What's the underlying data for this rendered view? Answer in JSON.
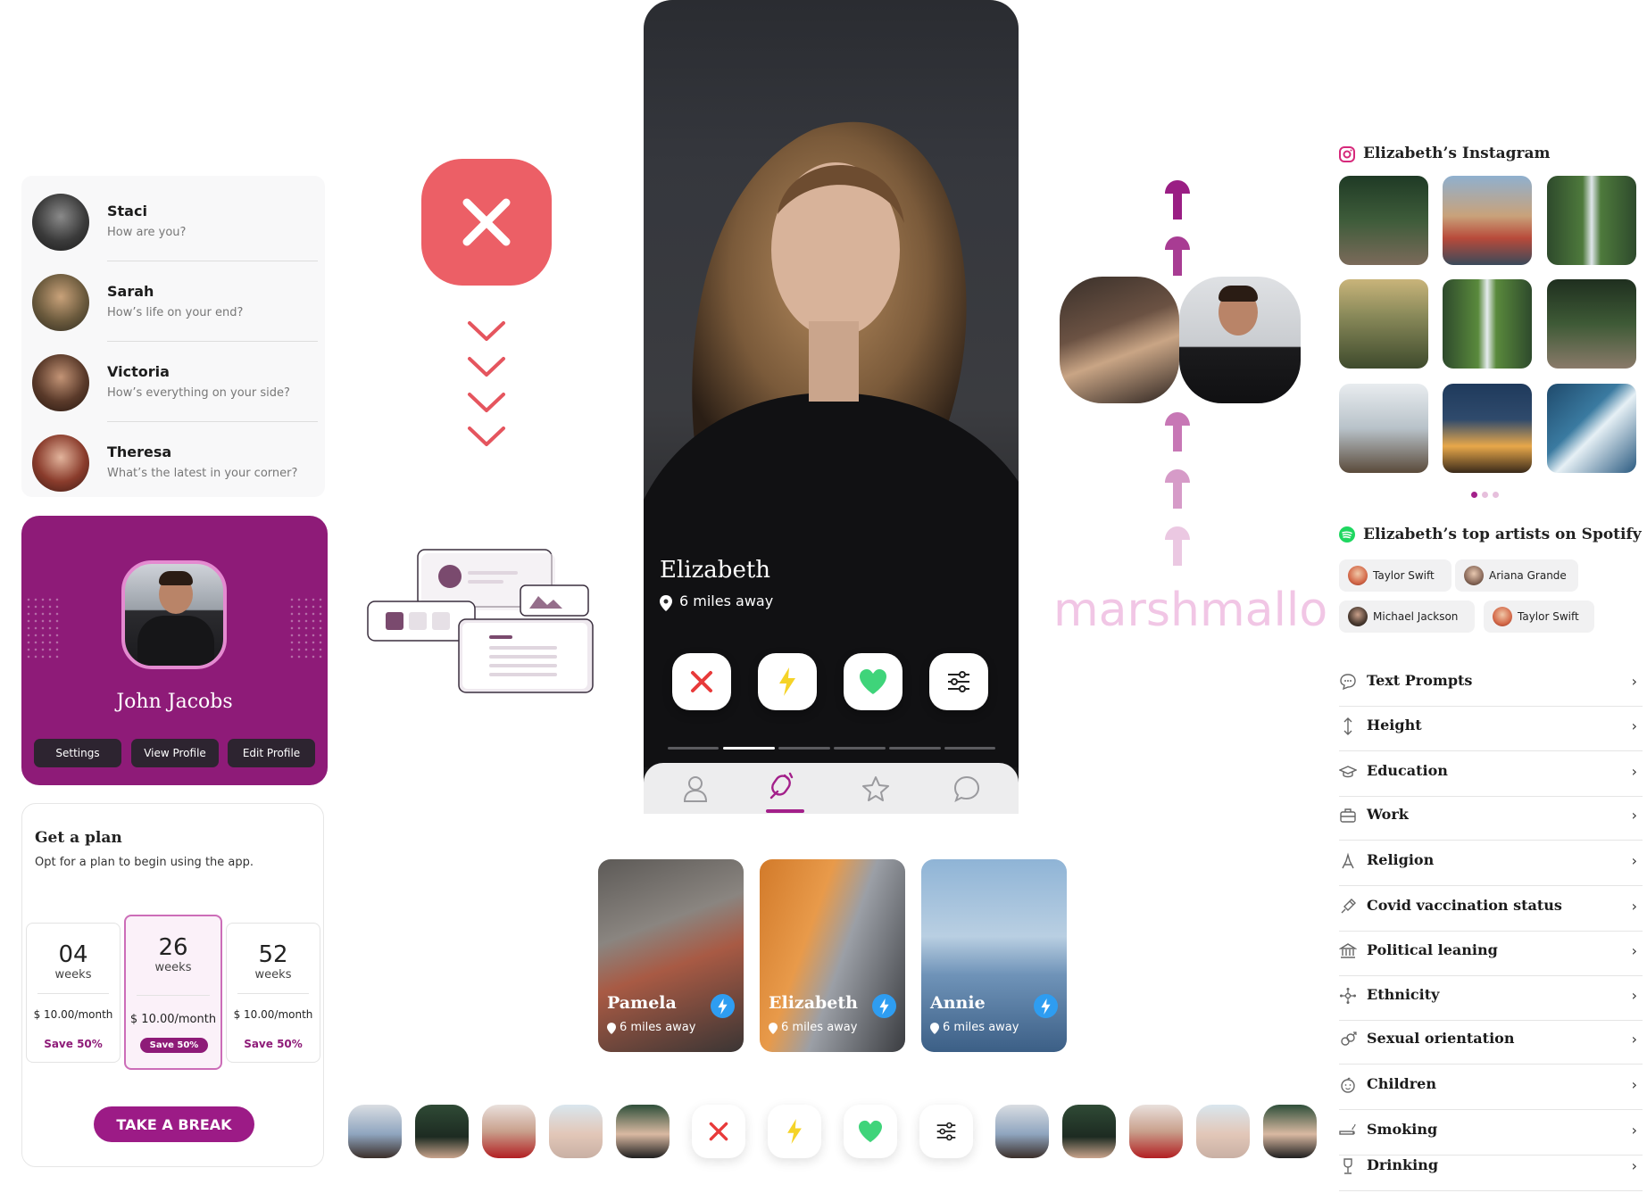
{
  "chats": [
    {
      "name": "Staci",
      "message": "How are you?"
    },
    {
      "name": "Sarah",
      "message": "How’s life on your end?"
    },
    {
      "name": "Victoria",
      "message": "How’s everything on your side?"
    },
    {
      "name": "Theresa",
      "message": "What’s the latest in your corner?"
    }
  ],
  "profile": {
    "name": "John Jacobs",
    "buttons": [
      "Settings",
      "View Profile",
      "Edit Profile"
    ]
  },
  "plan": {
    "title": "Get a plan",
    "subtitle": "Opt for a plan to begin using the app.",
    "options": [
      {
        "num": "04",
        "unit": "weeks",
        "price": "$ 10.00/month",
        "save": "Save 50%"
      },
      {
        "num": "26",
        "unit": "weeks",
        "price": "$ 10.00/month",
        "save": "Save 50%"
      },
      {
        "num": "52",
        "unit": "weeks",
        "price": "$ 10.00/month",
        "save": "Save 50%"
      }
    ],
    "cta": "TAKE A BREAK"
  },
  "phone": {
    "name": "Elizabeth",
    "distance": "6 miles away"
  },
  "cards": [
    {
      "name": "Pamela",
      "distance": "6 miles away"
    },
    {
      "name": "Elizabeth",
      "distance": "6 miles away"
    },
    {
      "name": "Annie",
      "distance": "6 miles away"
    }
  ],
  "brand": "marshmallo",
  "instagram": {
    "title": "Elizabeth’s Instagram"
  },
  "spotify": {
    "title": "Elizabeth’s top artists on Spotify",
    "artists": [
      "Taylor Swift",
      "Ariana Grande",
      "Michael Jackson",
      "Taylor Swift"
    ]
  },
  "attributes": [
    {
      "label": "Text Prompts",
      "icon": "chat-bubble-icon"
    },
    {
      "label": "Height",
      "icon": "height-icon"
    },
    {
      "label": "Education",
      "icon": "graduation-cap-icon"
    },
    {
      "label": "Work",
      "icon": "briefcase-icon"
    },
    {
      "label": "Religion",
      "icon": "praying-hands-icon"
    },
    {
      "label": "Covid vaccination status",
      "icon": "syringe-icon"
    },
    {
      "label": "Political leaning",
      "icon": "government-building-icon"
    },
    {
      "label": "Ethnicity",
      "icon": "network-icon"
    },
    {
      "label": "Sexual orientation",
      "icon": "gender-icon"
    },
    {
      "label": "Children",
      "icon": "baby-face-icon"
    },
    {
      "label": "Smoking",
      "icon": "cigarette-icon"
    },
    {
      "label": "Drinking",
      "icon": "wine-glass-icon"
    }
  ],
  "colors": {
    "brand": "#8e1b78",
    "accent_pink": "#f1c6e5",
    "dislike_red": "#ec5f66",
    "like_green": "#3fd47a",
    "boost_yellow": "#f5d327"
  }
}
